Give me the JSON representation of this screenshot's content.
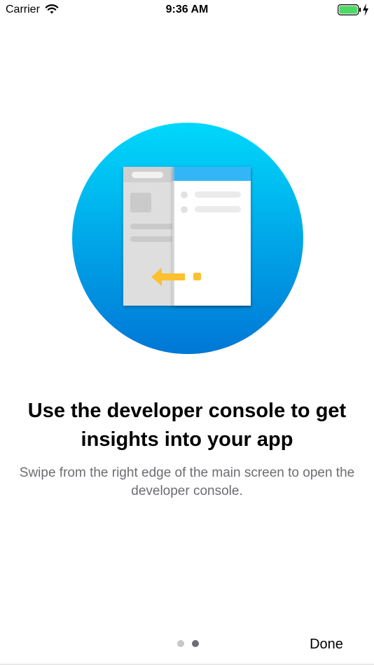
{
  "status_bar": {
    "carrier": "Carrier",
    "time": "9:36 AM",
    "battery_color": "#4cd964"
  },
  "onboarding": {
    "headline": "Use the developer console to get insights into your app",
    "subtitle": "Swipe from the right edge of the main screen to open the developer console.",
    "illustration_icon": "developer-console-swipe-illustration",
    "accent_colors": {
      "circle_top": "#00d8fb",
      "circle_bottom": "#0077d6",
      "arrow": "#fdc02f"
    }
  },
  "pager": {
    "page_count": 2,
    "current_page": 2
  },
  "footer": {
    "done_label": "Done"
  }
}
